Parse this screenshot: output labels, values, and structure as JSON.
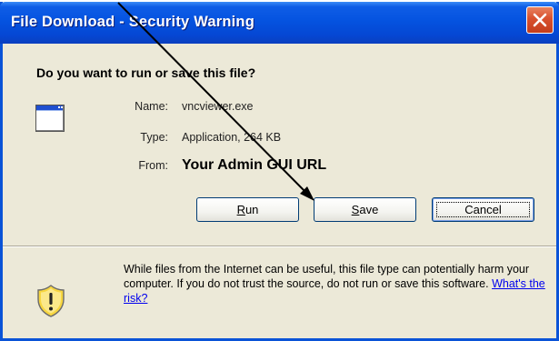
{
  "window": {
    "title": "File Download - Security Warning"
  },
  "dialog": {
    "question": "Do you want to run or save this file?",
    "file": {
      "icon": "application-window-icon",
      "name_label": "Name:",
      "name_value": "vncviewer.exe",
      "type_label": "Type:",
      "type_value": "Application, 264 KB",
      "from_label": "From:",
      "from_value": "Your Admin GUI URL"
    },
    "buttons": {
      "run": {
        "accel": "R",
        "rest": "un"
      },
      "save": {
        "accel": "S",
        "rest": "ave"
      },
      "cancel": "Cancel"
    },
    "warning": {
      "icon": "security-shield-icon",
      "text": "While files from the Internet can be useful, this file type can potentially harm your computer. If you do not trust the source, do not run or save this software.",
      "link": "What's the risk?"
    }
  },
  "colors": {
    "title_bar": "#0553e0",
    "dialog_bg": "#ece9d8",
    "close_button": "#d8502e",
    "link": "#0000ee",
    "button_border": "#003c74"
  }
}
